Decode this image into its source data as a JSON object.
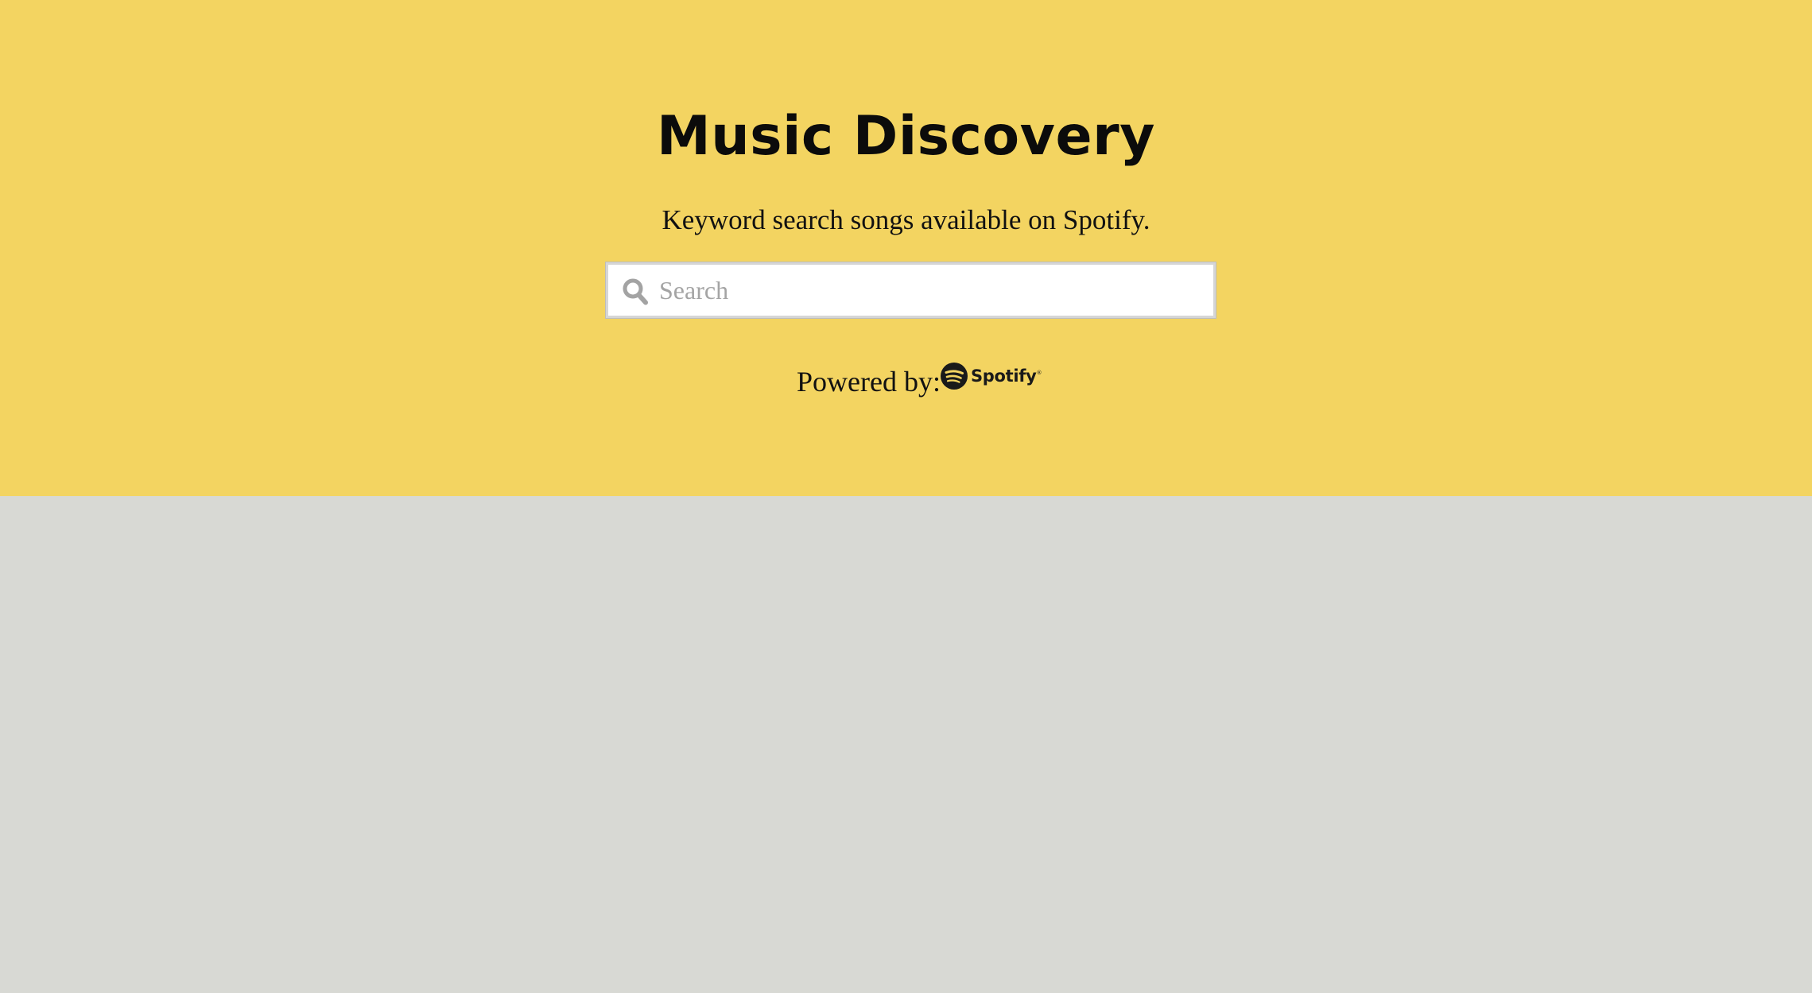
{
  "hero": {
    "title": "Music Discovery",
    "subtitle": "Keyword search songs available on Spotify.",
    "background_color": "#f3d461"
  },
  "search": {
    "placeholder": "Search",
    "value": "",
    "icon": "search-icon"
  },
  "footer": {
    "powered_label": "Powered by:",
    "logo_icon": "spotify-logo",
    "logo_text": "Spotify",
    "logo_mark": "®"
  },
  "page": {
    "background_color": "#d8d9d4"
  }
}
